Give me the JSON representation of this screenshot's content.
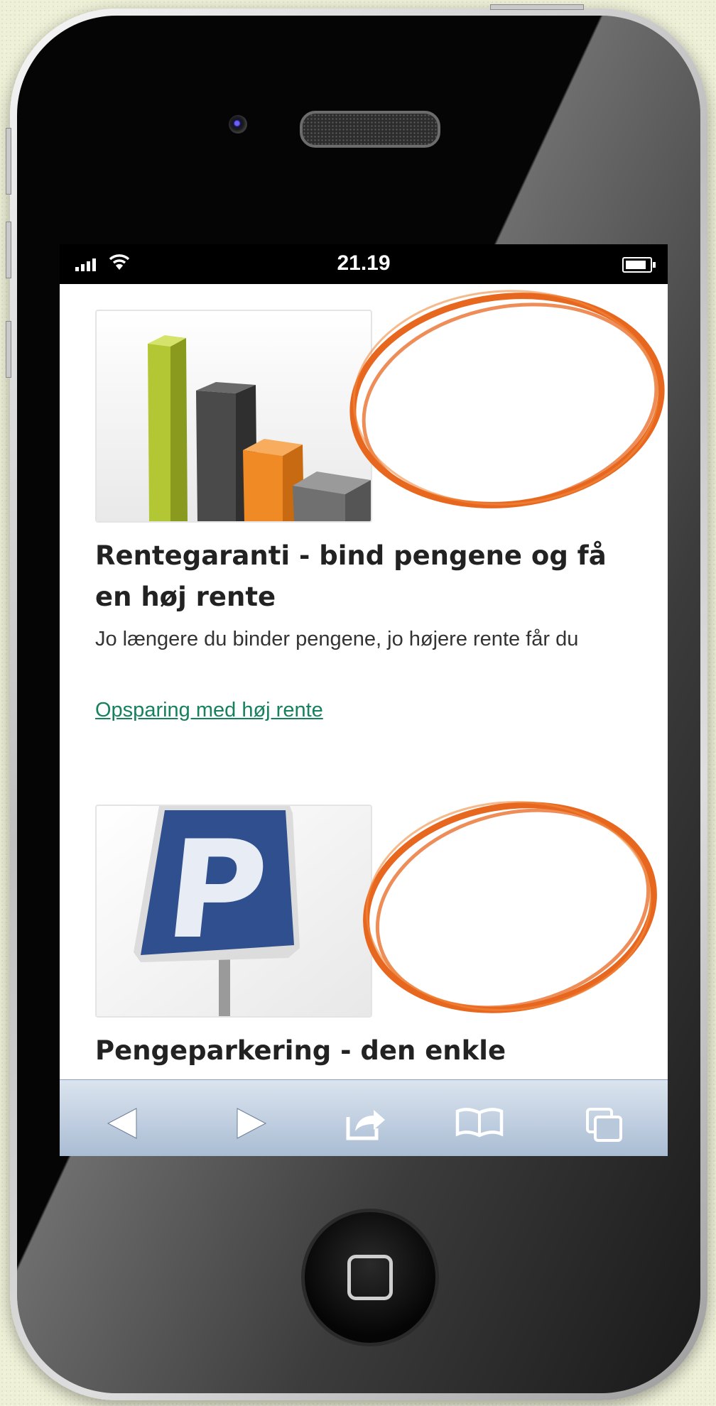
{
  "device": {
    "type": "iphone",
    "home_button_icon": "rounded-square-icon"
  },
  "status_bar": {
    "time": "21.19",
    "signal_icon": "signal-bars-icon",
    "wifi_icon": "wifi-icon",
    "battery_icon": "battery-icon"
  },
  "promos": [
    {
      "image_icon": "bar-chart-icon",
      "title": "Rentegaranti - bind pengene og få en høj rente",
      "text": "Jo længere du binder pengene, jo højere rente får du",
      "link": "Opsparing med høj rente"
    },
    {
      "image_icon": "parking-sign-icon",
      "title": "Pengeparkering - den enkle"
    }
  ],
  "toolbar": {
    "buttons": [
      "back-icon",
      "forward-icon",
      "share-icon",
      "bookmarks-icon",
      "tabs-icon"
    ]
  },
  "annotation": {
    "highlight_color": "#e8671f"
  },
  "colors": {
    "link": "#17805e",
    "toolbar_top": "#dbe4ef",
    "toolbar_bottom": "#a9bcd3",
    "chart_green": "#b3c633",
    "chart_dark": "#4a4a4a",
    "chart_orange": "#f08a24",
    "chart_gray": "#707070",
    "sign_blue": "#2f4f8e"
  }
}
